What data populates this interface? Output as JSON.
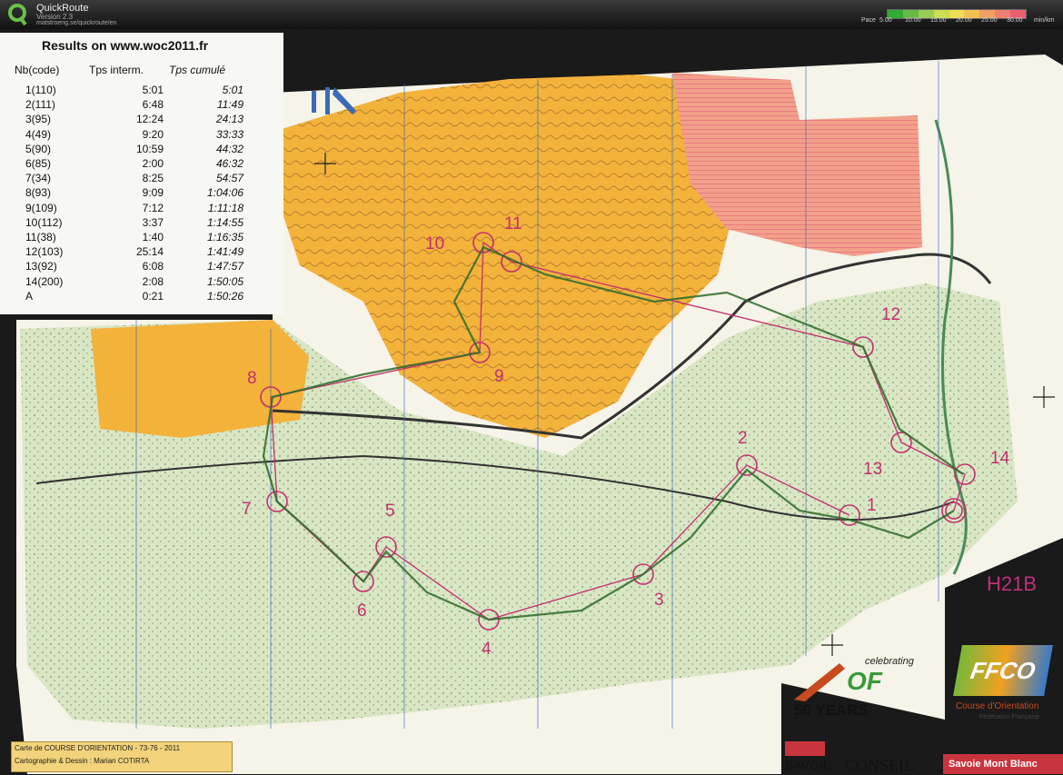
{
  "app": {
    "title": "QuickRoute",
    "version": "Version 2.3",
    "url": "matstroeng.se/quickroute/en"
  },
  "pace_legend": {
    "label": "Pace",
    "ticks": [
      "5.00",
      "10.00",
      "15.00",
      "20.00",
      "25.00",
      "30.00"
    ],
    "unit": "min/km",
    "colors": [
      "#33aa33",
      "#66bb44",
      "#99cc55",
      "#ccdd55",
      "#eedd55",
      "#f2c050",
      "#f0a060",
      "#ee8070",
      "#e96070"
    ]
  },
  "results": {
    "title": "Results on www.woc2011.fr",
    "headers": [
      "Nb(code)",
      "Tps interm.",
      "Tps cumulé"
    ],
    "rows": [
      [
        "1(110)",
        "5:01",
        "5:01"
      ],
      [
        "2(111)",
        "6:48",
        "11:49"
      ],
      [
        "3(95)",
        "12:24",
        "24:13"
      ],
      [
        "4(49)",
        "9:20",
        "33:33"
      ],
      [
        "5(90)",
        "10:59",
        "44:32"
      ],
      [
        "6(85)",
        "2:00",
        "46:32"
      ],
      [
        "7(34)",
        "8:25",
        "54:57"
      ],
      [
        "8(93)",
        "9:09",
        "1:04:06"
      ],
      [
        "9(109)",
        "7:12",
        "1:11:18"
      ],
      [
        "10(112)",
        "3:37",
        "1:14:55"
      ],
      [
        "11(38)",
        "1:40",
        "1:16:35"
      ],
      [
        "12(103)",
        "25:14",
        "1:41:49"
      ],
      [
        "13(92)",
        "6:08",
        "1:47:57"
      ],
      [
        "14(200)",
        "2:08",
        "1:50:05"
      ],
      [
        "A",
        "0:21",
        "1:50:26"
      ]
    ]
  },
  "map": {
    "course_label": "H21B",
    "controls": [
      "1",
      "2",
      "3",
      "4",
      "5",
      "6",
      "7",
      "8",
      "9",
      "10",
      "11",
      "12",
      "13",
      "14"
    ]
  },
  "footer": {
    "line1": "Carte de COURSE D'ORIENTATION - 73-76 - 2011",
    "line2": "Cartographie & Dessin : Marian COTIRTA",
    "of_celebrating": "celebrating",
    "of_mark": "OF",
    "of_years": "50 YEARS",
    "ffco_letters": "FFCO",
    "ffco_name": "Course d'Orientation",
    "ffco_sub": "Fédération Française",
    "savoie_left": "SAVOIE",
    "savoie_right": "CONSEIL",
    "red_text": "Savoie Mont Blanc"
  }
}
